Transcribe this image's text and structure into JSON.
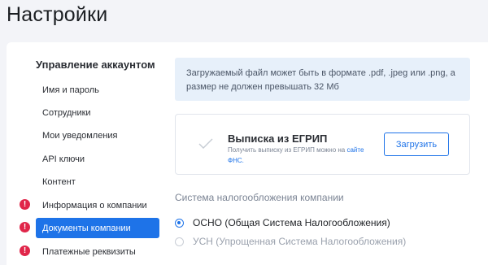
{
  "page": {
    "title": "Настройки"
  },
  "sidebar": {
    "heading": "Управление аккаунтом",
    "items": [
      {
        "label": "Имя и пароль",
        "alert": false,
        "active": false
      },
      {
        "label": "Сотрудники",
        "alert": false,
        "active": false
      },
      {
        "label": "Мои уведомления",
        "alert": false,
        "active": false
      },
      {
        "label": "API ключи",
        "alert": false,
        "active": false
      },
      {
        "label": "Контент",
        "alert": false,
        "active": false
      },
      {
        "label": "Информация о компании",
        "alert": true,
        "active": false
      },
      {
        "label": "Документы компании",
        "alert": true,
        "active": true
      },
      {
        "label": "Платежные реквизиты",
        "alert": true,
        "active": false
      }
    ],
    "alert_symbol": "!"
  },
  "info": {
    "text": "Загружаемый файл может быть в формате .pdf, .jpeg или .png, а размер не должен превышать 32 Мб"
  },
  "egrip": {
    "title": "Выписка из ЕГРИП",
    "desc": "Получить выписку из ЕГРИП можно на",
    "link": "сайте ФНС.",
    "upload_label": "Загрузить",
    "icon": "check-icon"
  },
  "tax": {
    "title": "Система налогообложения компании",
    "options": [
      {
        "label": "ОСНО (Общая Система Налогообложения)",
        "selected": true
      },
      {
        "label": "УСН (Упрощенная Система Налогообложения)",
        "selected": false
      }
    ]
  },
  "colors": {
    "accent": "#1e73e8",
    "alert": "#e0264a",
    "info_bg": "#e7f0fa",
    "page_bg": "#f3f4f8"
  }
}
